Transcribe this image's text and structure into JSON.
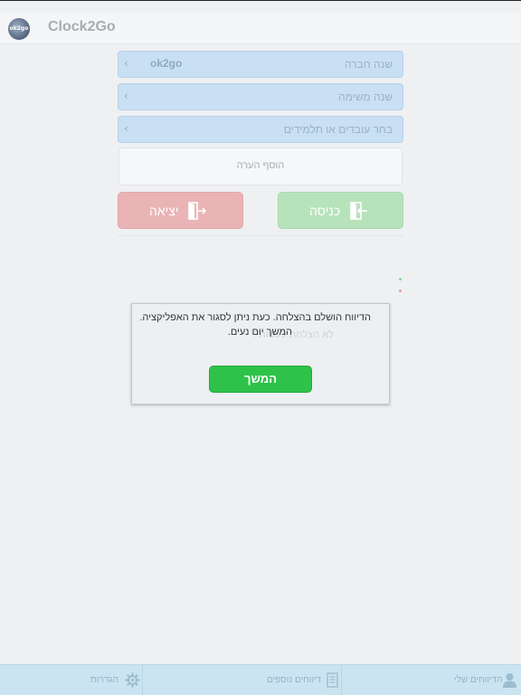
{
  "app": {
    "title": "Clock2Go",
    "logo_text": "ok2go"
  },
  "form": {
    "company_year": {
      "label": "שנה חברה",
      "value": "ok2go"
    },
    "task_year": {
      "label": "שנה משימה"
    },
    "employees": {
      "label": "בחר עובדים או תלמידים"
    },
    "note": {
      "placeholder": "הוסף הערה"
    }
  },
  "actions": {
    "exit_label": "יציאה",
    "enter_label": "כניסה"
  },
  "dialog": {
    "line1": "הדיווח הושלם בהצלחה. כעת ניתן לסגור את האפליקציה.",
    "line2": "המשך יום נעים.",
    "ghost_text": "לא הצלחת לעשות?",
    "continue_label": "המשך"
  },
  "tabbar": {
    "my_reports": "הדיווחים שלי",
    "more_reports": "דיווחים נוספים",
    "settings": "הגדרות"
  },
  "colors": {
    "select_row_bg": "#c9dff3",
    "exit_bg": "#eab4b6",
    "enter_bg": "#b7e3bb",
    "continue_bg": "#2ec24a",
    "tabbar_bg": "#cbe4f1"
  },
  "icons": {
    "logo": "clock2go-logo",
    "chevron": "chevron-left-icon",
    "exit": "door-exit-icon",
    "enter": "door-enter-icon",
    "tab_user": "user-icon",
    "tab_list": "document-list-icon",
    "tab_settings": "gear-icon"
  }
}
